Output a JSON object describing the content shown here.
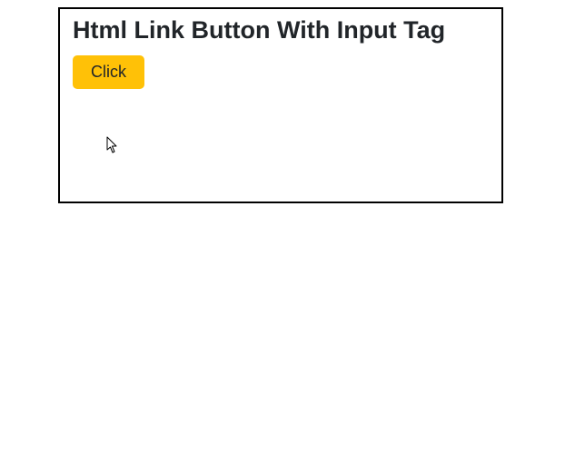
{
  "heading": "Html Link Button With Input Tag",
  "button": {
    "label": "Click"
  },
  "colors": {
    "button_bg": "#ffc107",
    "button_text": "#212529",
    "panel_border": "#000000"
  }
}
